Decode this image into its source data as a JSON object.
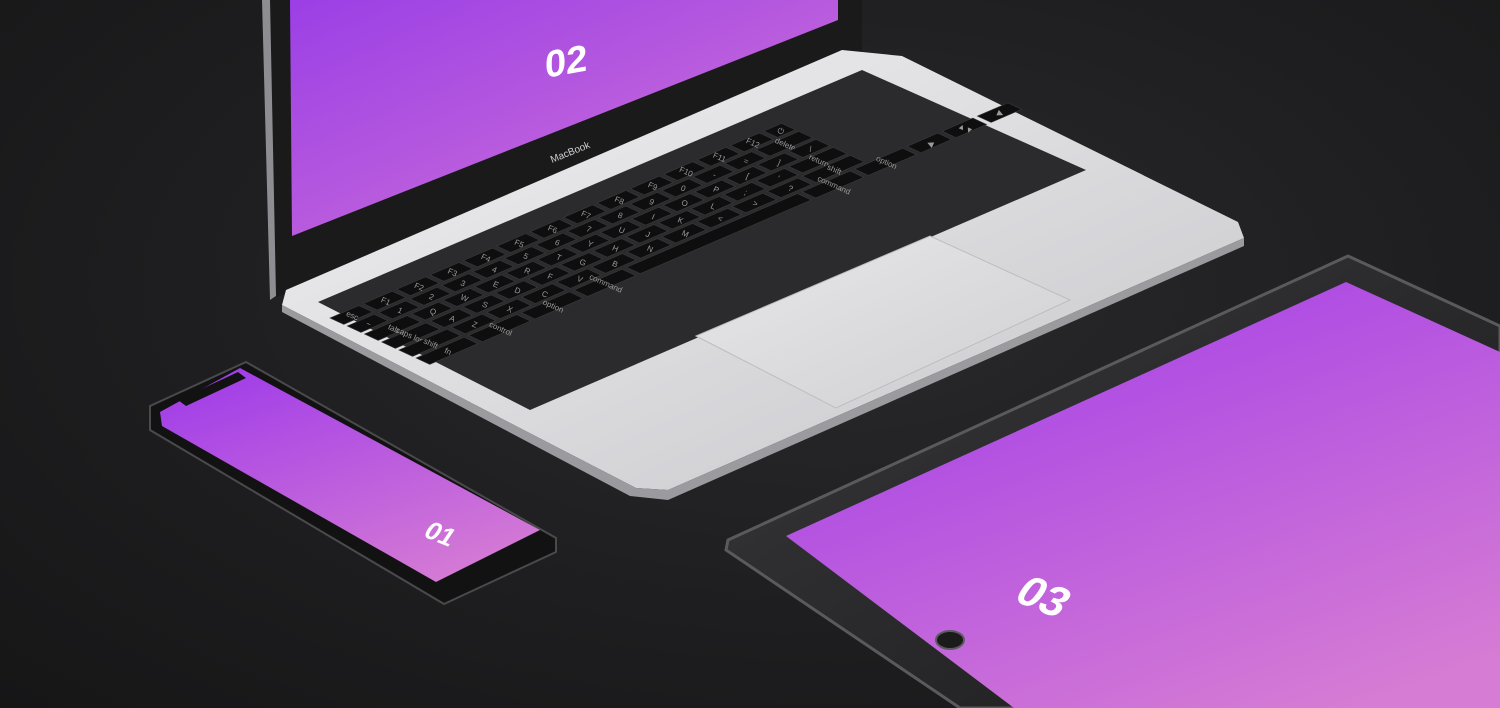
{
  "devices": {
    "phone": {
      "screen_label": "01"
    },
    "laptop": {
      "screen_label": "02",
      "brand_label": "MacBook"
    },
    "tablet": {
      "screen_label": "03"
    }
  },
  "keyboard": {
    "rows": [
      [
        "esc",
        "F1",
        "F2",
        "F3",
        "F4",
        "F5",
        "F6",
        "F7",
        "F8",
        "F9",
        "F10",
        "F11",
        "F12",
        "⏻"
      ],
      [
        "~",
        "1",
        "2",
        "3",
        "4",
        "5",
        "6",
        "7",
        "8",
        "9",
        "0",
        "-",
        "=",
        "delete"
      ],
      [
        "tab",
        "Q",
        "W",
        "E",
        "R",
        "T",
        "Y",
        "U",
        "I",
        "O",
        "P",
        "[",
        "]",
        "\\"
      ],
      [
        "caps lock",
        "A",
        "S",
        "D",
        "F",
        "G",
        "H",
        "J",
        "K",
        "L",
        ";",
        "'",
        "return"
      ],
      [
        "shift",
        "Z",
        "X",
        "C",
        "V",
        "B",
        "N",
        "M",
        "<",
        ">",
        "?",
        "shift"
      ],
      [
        "fn",
        "control",
        "option",
        "command",
        "",
        "command",
        "option",
        "◀",
        "▲▼",
        "▶"
      ]
    ]
  },
  "colors": {
    "screen_gradient_start": "#9b3fe6",
    "screen_gradient_end": "#d476d6",
    "aluminium": "#d9d9dc",
    "bezel": "#0c0c0d"
  }
}
